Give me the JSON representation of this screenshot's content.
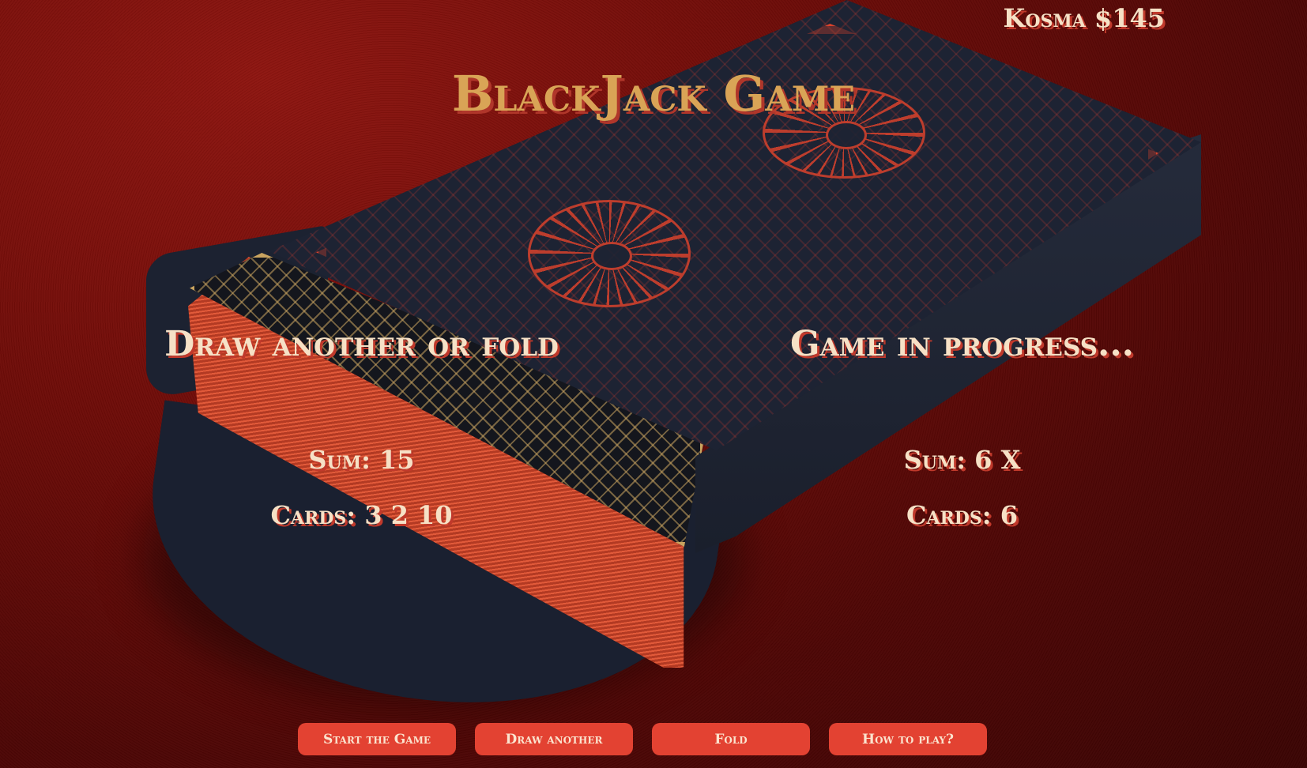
{
  "wallet": {
    "text": "Kosma $145"
  },
  "title": "BlackJack Game",
  "player": {
    "status": "Draw another or fold",
    "sum": "Sum: 15",
    "cards": "Cards: 3 2 10"
  },
  "dealer": {
    "status": "Game in progress...",
    "sum": "Sum: 6 X",
    "cards": "Cards: 6"
  },
  "buttons": {
    "start": "Start the Game",
    "draw": "Draw another",
    "fold": "Fold",
    "help": "How to play?"
  },
  "colors": {
    "background": "#6e0c08",
    "title": "#d9a456",
    "text": "#f6e1c6",
    "text_shadow": "#c0392b",
    "button": "#e34232"
  }
}
